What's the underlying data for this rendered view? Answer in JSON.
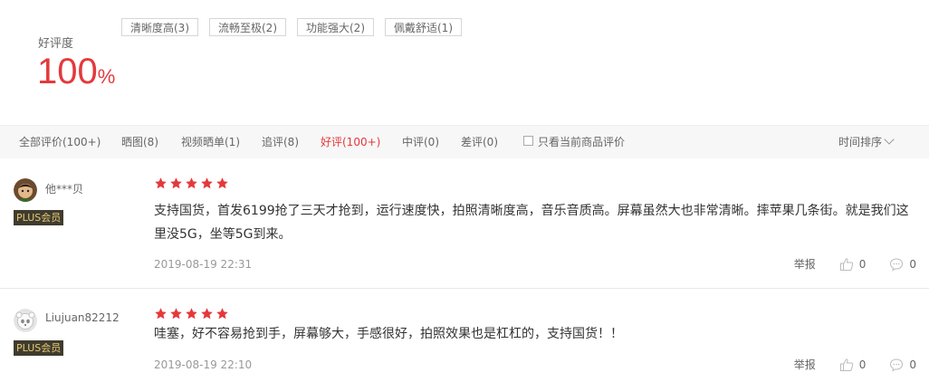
{
  "rating": {
    "label": "好评度",
    "value": "100",
    "unit": "%"
  },
  "tags": [
    "清晰度高(3)",
    "流畅至极(2)",
    "功能强大(2)",
    "佩戴舒适(1)"
  ],
  "filters": {
    "all": "全部评价(100+)",
    "photo": "晒图(8)",
    "video": "视频晒单(1)",
    "followup": "追评(8)",
    "good": "好评(100+)",
    "medium": "中评(0)",
    "bad": "差评(0)",
    "current_only": "只看当前商品评价",
    "sort": "时间排序"
  },
  "colors": {
    "accent": "#e4393c",
    "plus_bg": "#3f3c2e",
    "plus_text": "#e8c874"
  },
  "reviews": [
    {
      "user": "他***贝",
      "badge": "PLUS会员",
      "stars": 5,
      "content": "支持国货，首发6199抢了三天才抢到，运行速度快，拍照清晰度高，音乐音质高。屏幕虽然大也非常清晰。摔苹果几条街。就是我们这里没5G，坐等5G到来。",
      "date": "2019-08-19 22:31",
      "report": "举报",
      "likes": "0",
      "replies": "0"
    },
    {
      "user": "Liujuan82212",
      "badge": "PLUS会员",
      "stars": 5,
      "content": "哇塞，好不容易抢到手，屏幕够大，手感很好，拍照效果也是杠杠的，支持国货！！",
      "date": "2019-08-19 22:10",
      "report": "举报",
      "likes": "0",
      "replies": "0"
    }
  ]
}
